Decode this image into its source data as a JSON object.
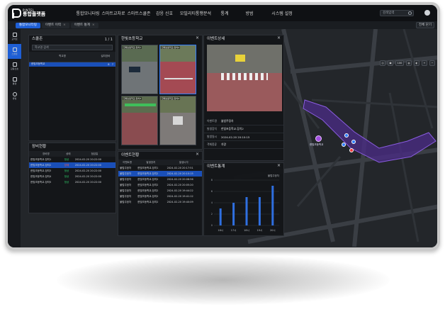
{
  "brand": {
    "sub": "PINTEL",
    "name": "통합플랫폼"
  },
  "nav": [
    "통합모니터링",
    "스마트교차로",
    "스마트스쿨존",
    "감응 신호",
    "모빌리티통행분석",
    "통계",
    "방범",
    "시스템 설정"
  ],
  "search": {
    "placeholder": "검색입력"
  },
  "tabs": [
    "통합모니터링",
    "이벤트 이력",
    "이벤트 통계"
  ],
  "full_button": "전체 닫기",
  "sidebar": [
    "교차로",
    "스쿨존",
    "감응신호",
    "통행",
    "방범"
  ],
  "map": {
    "controls": [
      "100"
    ],
    "school_marker_label": "한빛초등학교"
  },
  "schoolzone": {
    "title": "스쿨존",
    "count": "1 / 1",
    "search_placeholder": "학교명 검색",
    "headers": [
      "학교명",
      "설치장비",
      "설치장비",
      "공영장비"
    ],
    "rows": [
      [
        "한빛초등학교",
        "8",
        "7"
      ]
    ]
  },
  "equipment": {
    "title": "장비현황",
    "headers": [
      "장비명",
      "상태",
      "점검일"
    ],
    "rows": [
      [
        "한빛초등학교-장치1",
        "정상",
        "2024-02-20 20:22:00",
        "g"
      ],
      [
        "한빛초등학교-장치2",
        "장애",
        "2024-02-20 20:22:00",
        "r"
      ],
      [
        "한빛초등학교-장치3",
        "정상",
        "2024-02-20 20:22:00",
        "g"
      ],
      [
        "한빛초등학교-장치4",
        "정상",
        "2024-02-20 20:22:00",
        "g"
      ],
      [
        "한빛초등학교-장치5",
        "정상",
        "2024-02-20 20:22:00",
        "g"
      ]
    ]
  },
  "cameras": {
    "title": "한빛초등학교",
    "labels": [
      "한빛초등학교-장치1",
      "한빛초등학교-장치2",
      "한빛초등학교-장치3",
      "한빛초등학교-장치4"
    ]
  },
  "event_status": {
    "title": "이벤트현황",
    "headers": [
      "이벤트명",
      "발생장치",
      "발생시각"
    ],
    "rows": [
      [
        "불법주정차",
        "한빛초등학교-장치1",
        "2024-02-20 20:17:51"
      ],
      [
        "불법주정차",
        "한빛초등학교-장치2",
        "2024-02-20 20:10:15"
      ],
      [
        "불법주정차",
        "한빛초등학교-장치2",
        "2024-02-20 20:08:56"
      ],
      [
        "불법주정차",
        "한빛초등학교-장치2",
        "2024-02-20 20:05:20"
      ],
      [
        "불법주정차",
        "한빛초등학교-장치2",
        "2024-02-20 19:44:22"
      ],
      [
        "불법주정차",
        "한빛초등학교-장치2",
        "2024-02-20 19:41:12"
      ],
      [
        "불법주정차",
        "한빛초등학교-장치2",
        "2024-02-20 19:40:09"
      ]
    ]
  },
  "event_detail": {
    "title": "이벤트상세",
    "rows": [
      [
        "이벤트명",
        "불법주정차"
      ],
      [
        "발생장치",
        "한빛초등학교-장치2"
      ],
      [
        "발생일시",
        "2024-02-20 20:10:15"
      ],
      [
        "객체종류",
        "차량"
      ]
    ]
  },
  "chart_data": {
    "type": "bar",
    "title": "이벤트통계",
    "legend": "불법주정차",
    "categories": [
      "16시",
      "17시",
      "18시",
      "19시",
      "20시"
    ],
    "values": [
      3,
      4,
      5,
      5,
      7
    ],
    "ylim": [
      0,
      8
    ],
    "color": "#2f6fe0"
  },
  "colors": {
    "accent": "#1e5fd6",
    "zone": "#6a3bb0",
    "ok": "#2fcf6a",
    "fault": "#ef5a4f"
  }
}
